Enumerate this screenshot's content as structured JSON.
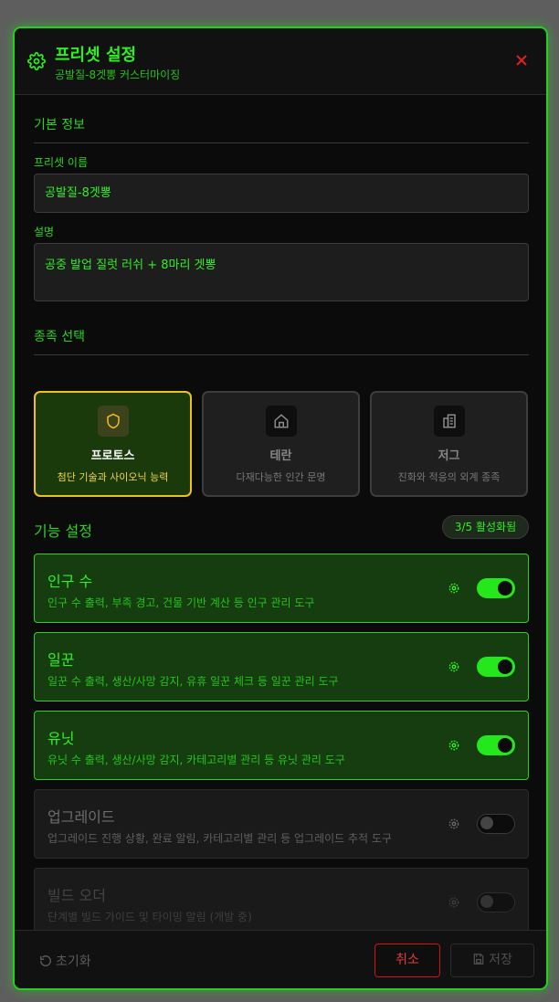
{
  "header": {
    "title": "프리셋 설정",
    "subtitle": "공발질-8겟뽕 커스터마이징"
  },
  "basic": {
    "section_title": "기본 정보",
    "name_label": "프리셋 이름",
    "name_value": "공발질-8겟뽕",
    "desc_label": "설명",
    "desc_value": "공중 발업 질럿 러쉬 + 8마리 겟뽕"
  },
  "race": {
    "section_title": "종족 선택",
    "options": [
      {
        "name": "프로토스",
        "desc": "첨단 기술과 사이오닉 능력",
        "icon": "shield-icon",
        "selected": true
      },
      {
        "name": "테란",
        "desc": "다재다능한 인간 문명",
        "icon": "home-icon",
        "selected": false
      },
      {
        "name": "저그",
        "desc": "진화와 적응의 외계 종족",
        "icon": "hive-icon",
        "selected": false
      }
    ]
  },
  "features": {
    "section_title": "기능 설정",
    "badge": "3/5 활성화됨",
    "items": [
      {
        "title": "인구 수",
        "desc": "인구 수 출력, 부족 경고, 건물 기반 계산 등 인구 관리 도구",
        "enabled": true
      },
      {
        "title": "일꾼",
        "desc": "일꾼 수 출력, 생산/사망 감지, 유휴 일꾼 체크 등 일꾼 관리 도구",
        "enabled": true
      },
      {
        "title": "유닛",
        "desc": "유닛 수 출력, 생산/사망 감지, 카테고리별 관리 등 유닛 관리 도구",
        "enabled": true
      },
      {
        "title": "업그레이드",
        "desc": "업그레이드 진행 상황, 완료 알림, 카테고리별 관리 등 업그레이드 추적 도구",
        "enabled": false
      },
      {
        "title": "빌드 오더",
        "desc": "단계별 빌드 가이드 및 타이밍 알림 (개발 중)",
        "enabled": false
      }
    ]
  },
  "footer": {
    "reset_label": "초기화",
    "cancel_label": "취소",
    "save_label": "저장"
  },
  "colors": {
    "accent": "#22d31c",
    "selected_border": "#f2c01b",
    "cancel": "#cf1515"
  }
}
